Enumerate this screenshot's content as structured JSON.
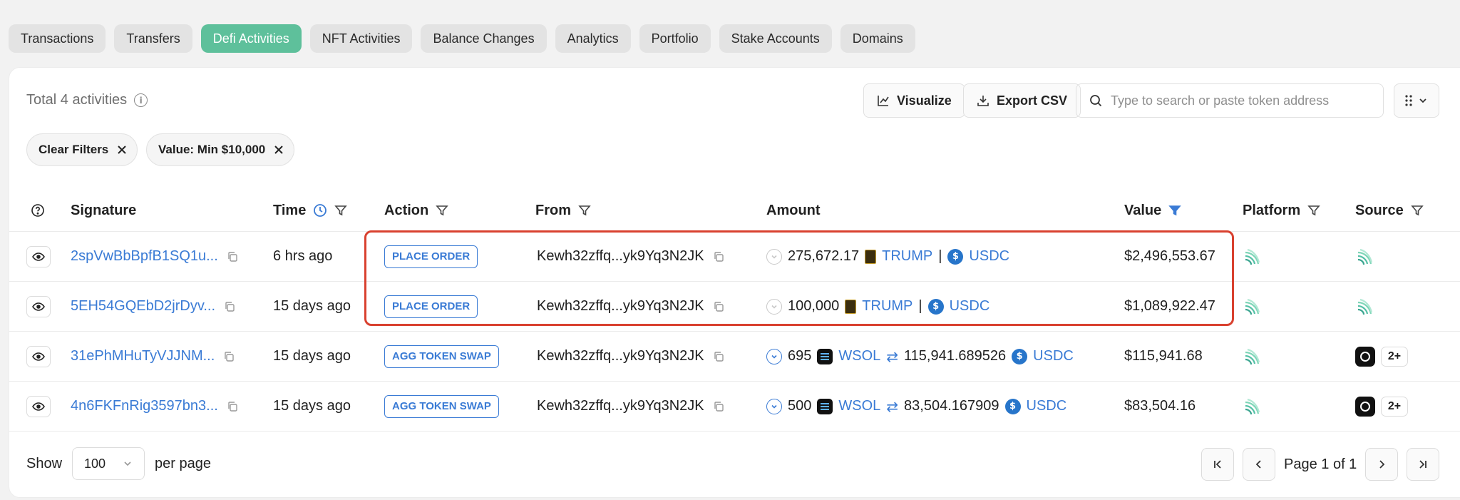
{
  "tabs": [
    {
      "label": "Transactions",
      "active": false
    },
    {
      "label": "Transfers",
      "active": false
    },
    {
      "label": "Defi Activities",
      "active": true
    },
    {
      "label": "NFT Activities",
      "active": false
    },
    {
      "label": "Balance Changes",
      "active": false
    },
    {
      "label": "Analytics",
      "active": false
    },
    {
      "label": "Portfolio",
      "active": false
    },
    {
      "label": "Stake Accounts",
      "active": false
    },
    {
      "label": "Domains",
      "active": false
    }
  ],
  "toolbar": {
    "total": "Total 4 activities",
    "visualize_label": "Visualize",
    "export_label": "Export CSV",
    "search_placeholder": "Type to search or paste token address"
  },
  "filters": {
    "clear_label": "Clear Filters",
    "value_filter": "Value: Min $10,000"
  },
  "columns": {
    "signature": "Signature",
    "time": "Time",
    "action": "Action",
    "from": "From",
    "amount": "Amount",
    "value": "Value",
    "platform": "Platform",
    "source": "Source"
  },
  "rows": [
    {
      "signature": "2spVwBbBpfB1SQ1u...",
      "time": "6 hrs ago",
      "action": "PLACE ORDER",
      "from": "Kewh32zffq...yk9Yq3N2JK",
      "amount1": "275,672.17",
      "token1": "TRUMP",
      "separator": "|",
      "token2": "USDC",
      "value": "$2,496,553.67"
    },
    {
      "signature": "5EH54GQEbD2jrDyv...",
      "time": "15 days ago",
      "action": "PLACE ORDER",
      "from": "Kewh32zffq...yk9Yq3N2JK",
      "amount1": "100,000",
      "token1": "TRUMP",
      "separator": "|",
      "token2": "USDC",
      "value": "$1,089,922.47"
    },
    {
      "signature": "31ePhMHuTyVJJNM...",
      "time": "15 days ago",
      "action": "AGG TOKEN SWAP",
      "from": "Kewh32zffq...yk9Yq3N2JK",
      "amount1": "695",
      "token1": "WSOL",
      "amount2": "115,941.689526",
      "token2": "USDC",
      "value": "$115,941.68",
      "source_more": "2+"
    },
    {
      "signature": "4n6FKFnRig3597bn3...",
      "time": "15 days ago",
      "action": "AGG TOKEN SWAP",
      "from": "Kewh32zffq...yk9Yq3N2JK",
      "amount1": "500",
      "token1": "WSOL",
      "amount2": "83,504.167909",
      "token2": "USDC",
      "value": "$83,504.16",
      "source_more": "2+"
    }
  ],
  "footer": {
    "show_label": "Show",
    "per_page_value": "100",
    "per_page_label": "per page",
    "page_text": "Page 1 of 1"
  },
  "colors": {
    "active_tab": "#5ec09b",
    "link": "#3a7bd5",
    "highlight": "#d9412f"
  }
}
